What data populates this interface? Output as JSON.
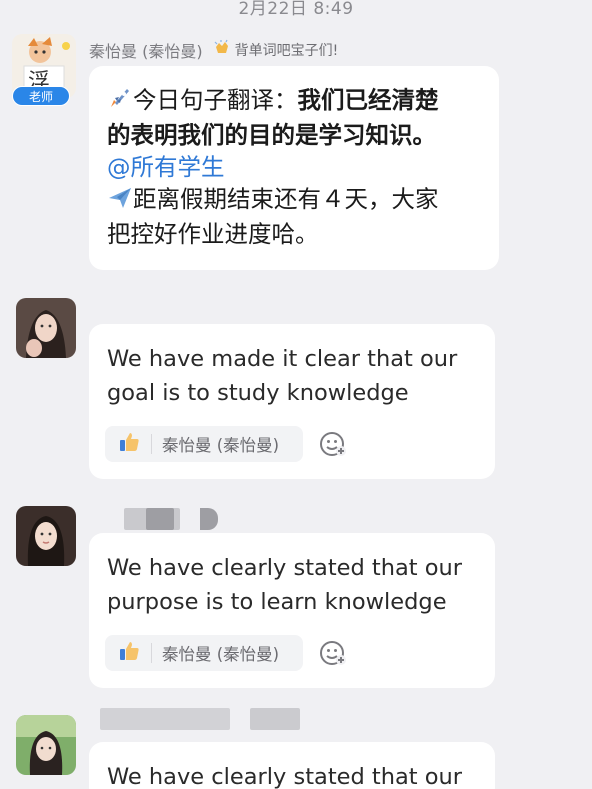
{
  "chat": {
    "timestamp": "2月22日 8:49",
    "teacher": {
      "name": "秦怡曼 (秦怡曼)",
      "role_badge": "老师",
      "motto": "背单词吧宝子们!",
      "message": {
        "prefix": "今日句子翻译：",
        "line1_bold": "我们已经清楚",
        "line2_bold": "的表明我们的目的是学习知识。",
        "mention": "@所有学生",
        "line4": "距离假期结束还有４天，大家",
        "line5": "把控好作业进度哈。"
      }
    },
    "replies": [
      {
        "text": "We have made it clear that our goal is to study knowledge",
        "reaction_user": "秦怡曼 (秦怡曼)"
      },
      {
        "text": "We have clearly stated that our purpose is to learn knowledge",
        "reaction_user": "秦怡曼 (秦怡曼)"
      },
      {
        "text": "We have clearly stated that our"
      }
    ]
  },
  "colors": {
    "background": "#f0f0f3",
    "bubble": "#ffffff",
    "mention": "#2f79d6",
    "role_badge": "#2a86e8",
    "reaction_chip": "#f2f3f5"
  },
  "icons": [
    "rocket-icon",
    "airplane-icon",
    "thumbs-up-icon",
    "add-emoji-icon",
    "clapping-hands-icon"
  ]
}
